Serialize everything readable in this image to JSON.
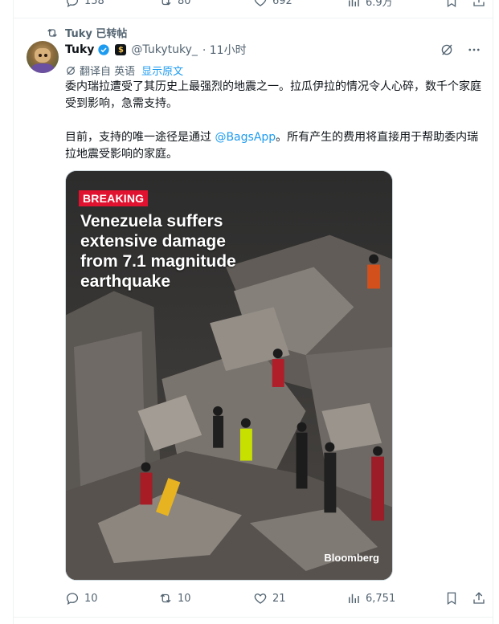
{
  "prev_tweet": {
    "replies": "158",
    "reposts": "80",
    "likes": "692",
    "views": "6.9万"
  },
  "repost_banner": "Tuky 已转帖",
  "tweet": {
    "display_name": "Tuky",
    "handle": "@Tukytuky_",
    "time": "· 11小时",
    "translate_label": "翻译自 英语",
    "show_original": "显示原文",
    "paragraph1": "委内瑞拉遭受了其历史上最强烈的地震之一。拉瓜伊拉的情况令人心碎，数千个家庭受到影响，急需支持。",
    "paragraph2_pre": "目前，支持的唯一途径是通过 ",
    "mention": "@BagsApp",
    "paragraph2_post": "。所有产生的费用将直接用于帮助委内瑞拉地震受影响的家庭。",
    "media": {
      "tag": "BREAKING",
      "headline": "Venezuela suffers extensive damage from 7.1 magnitude earthquake",
      "brand": "Bloomberg"
    },
    "stats": {
      "replies": "10",
      "reposts": "10",
      "likes": "21",
      "views": "6,751"
    }
  },
  "colors": {
    "accent": "#1d9bf0",
    "muted": "#536471",
    "breaking": "#e0122f"
  }
}
